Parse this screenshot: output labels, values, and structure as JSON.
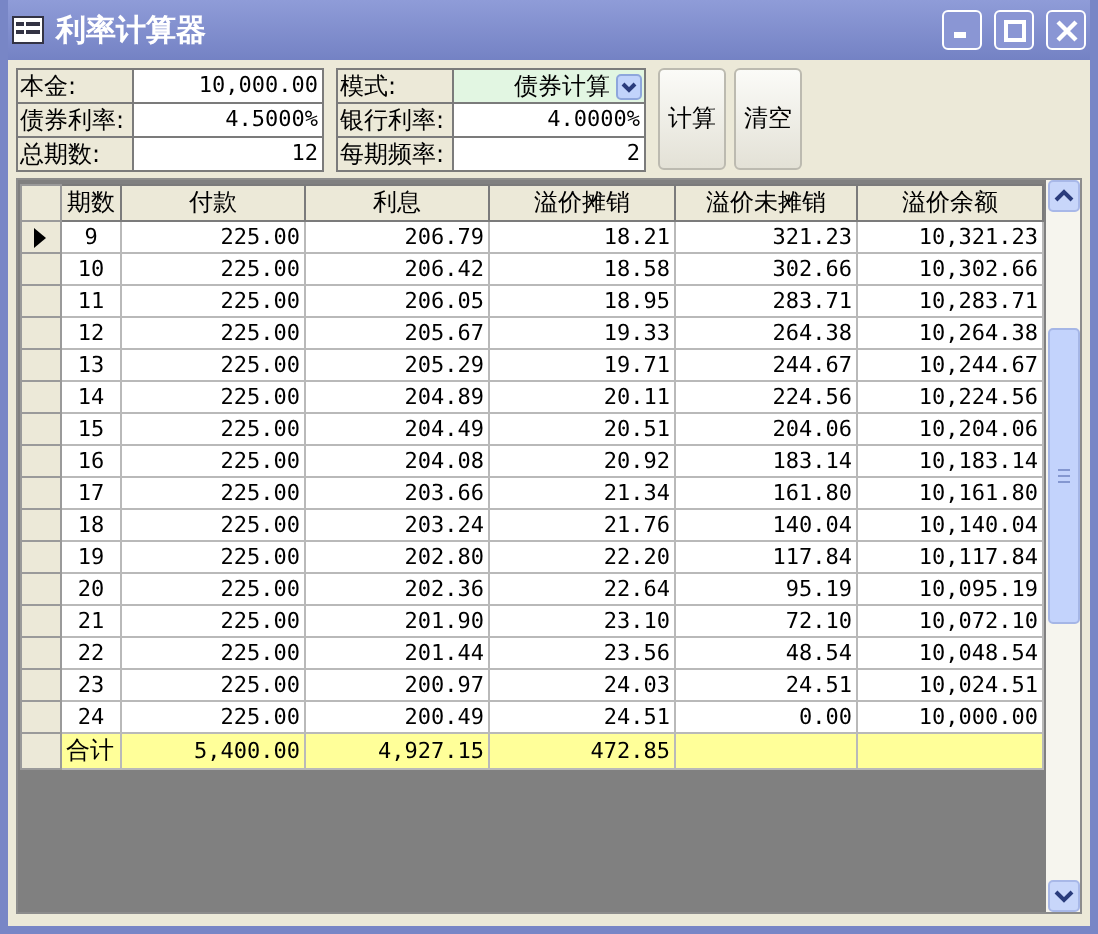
{
  "window": {
    "title": "利率计算器"
  },
  "form": {
    "left_fields": [
      {
        "kind": "text",
        "label": "本金:",
        "value": "10,000.00"
      },
      {
        "kind": "text",
        "label": "债券利率:",
        "value": "4.5000%"
      },
      {
        "kind": "text",
        "label": "总期数:",
        "value": "12"
      }
    ],
    "right_fields": [
      {
        "kind": "dropdown",
        "label": "模式:",
        "value": "债券计算"
      },
      {
        "kind": "text",
        "label": "银行利率:",
        "value": "4.0000%"
      },
      {
        "kind": "text",
        "label": "每期频率:",
        "value": "2"
      }
    ],
    "buttons": [
      "计算",
      "清空"
    ]
  },
  "grid": {
    "columns": [
      "期数",
      "付款",
      "利息",
      "溢价摊销",
      "溢价未摊销",
      "溢价余额"
    ],
    "rows": [
      {
        "current": true,
        "cells": [
          "9",
          "225.00",
          "206.79",
          "18.21",
          "321.23",
          "10,321.23"
        ]
      },
      {
        "current": false,
        "cells": [
          "10",
          "225.00",
          "206.42",
          "18.58",
          "302.66",
          "10,302.66"
        ]
      },
      {
        "current": false,
        "cells": [
          "11",
          "225.00",
          "206.05",
          "18.95",
          "283.71",
          "10,283.71"
        ]
      },
      {
        "current": false,
        "cells": [
          "12",
          "225.00",
          "205.67",
          "19.33",
          "264.38",
          "10,264.38"
        ]
      },
      {
        "current": false,
        "cells": [
          "13",
          "225.00",
          "205.29",
          "19.71",
          "244.67",
          "10,244.67"
        ]
      },
      {
        "current": false,
        "cells": [
          "14",
          "225.00",
          "204.89",
          "20.11",
          "224.56",
          "10,224.56"
        ]
      },
      {
        "current": false,
        "cells": [
          "15",
          "225.00",
          "204.49",
          "20.51",
          "204.06",
          "10,204.06"
        ]
      },
      {
        "current": false,
        "cells": [
          "16",
          "225.00",
          "204.08",
          "20.92",
          "183.14",
          "10,183.14"
        ]
      },
      {
        "current": false,
        "cells": [
          "17",
          "225.00",
          "203.66",
          "21.34",
          "161.80",
          "10,161.80"
        ]
      },
      {
        "current": false,
        "cells": [
          "18",
          "225.00",
          "203.24",
          "21.76",
          "140.04",
          "10,140.04"
        ]
      },
      {
        "current": false,
        "cells": [
          "19",
          "225.00",
          "202.80",
          "22.20",
          "117.84",
          "10,117.84"
        ]
      },
      {
        "current": false,
        "cells": [
          "20",
          "225.00",
          "202.36",
          "22.64",
          "95.19",
          "10,095.19"
        ]
      },
      {
        "current": false,
        "cells": [
          "21",
          "225.00",
          "201.90",
          "23.10",
          "72.10",
          "10,072.10"
        ]
      },
      {
        "current": false,
        "cells": [
          "22",
          "225.00",
          "201.44",
          "23.56",
          "48.54",
          "10,048.54"
        ]
      },
      {
        "current": false,
        "cells": [
          "23",
          "225.00",
          "200.97",
          "24.03",
          "24.51",
          "10,024.51"
        ]
      },
      {
        "current": false,
        "cells": [
          "24",
          "225.00",
          "200.49",
          "24.51",
          "0.00",
          "10,000.00"
        ]
      }
    ],
    "totals": {
      "label": "合计",
      "cells": [
        "5,400.00",
        "4,927.15",
        "472.85"
      ]
    }
  }
}
